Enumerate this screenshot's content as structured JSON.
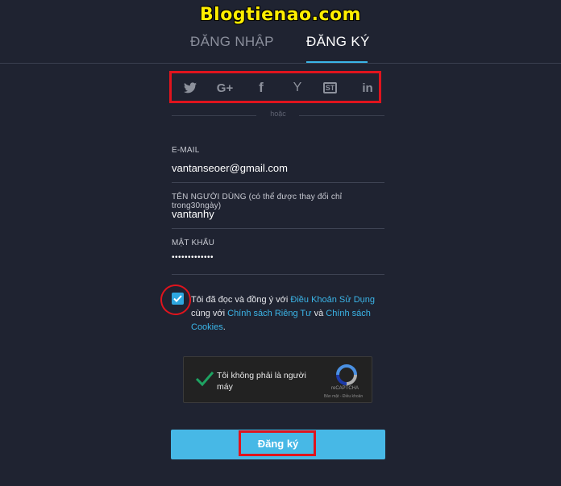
{
  "watermark": "Blogtienao.com",
  "tabs": {
    "login": "ĐĂNG NHẬP",
    "register": "ĐĂNG KÝ",
    "active": "register"
  },
  "social": {
    "icons": [
      "twitter-icon",
      "google-plus-icon",
      "facebook-icon",
      "yahoo-icon",
      "stocktwits-icon",
      "linkedin-icon"
    ],
    "labels": {
      "google_plus": "G+",
      "facebook": "f",
      "yahoo": "Y",
      "stocktwits": "ST",
      "linkedin": "in"
    }
  },
  "or_text": "hoặc",
  "form": {
    "email": {
      "label": "E-MAIL",
      "value": "vantanseoer@gmail.com"
    },
    "username": {
      "label": "TÊN NGƯỜI DÙNG (có thể được thay đổi chỉ trong30ngày)",
      "value": "vantanhy"
    },
    "password": {
      "label": "MẬT KHẨU",
      "value": "•••••••••••••"
    }
  },
  "terms": {
    "checked": true,
    "prefix": "Tôi đã đọc và đồng ý với ",
    "terms_link": "Điều Khoản Sử Dụng",
    "middle": " cùng với ",
    "privacy_link": "Chính sách Riêng Tư",
    "and": " và ",
    "cookies_link": "Chính sách Cookies",
    "suffix": "."
  },
  "captcha": {
    "text": "Tôi không phải là người máy",
    "brand": "reCAPTCHA",
    "links": "Bảo mật - Điều khoản"
  },
  "submit_label": "Đăng ký",
  "colors": {
    "background": "#1f2331",
    "accent": "#3bb5e8",
    "button": "#47b8e6",
    "annotation_red": "#e0141d",
    "watermark": "#ffee00"
  }
}
